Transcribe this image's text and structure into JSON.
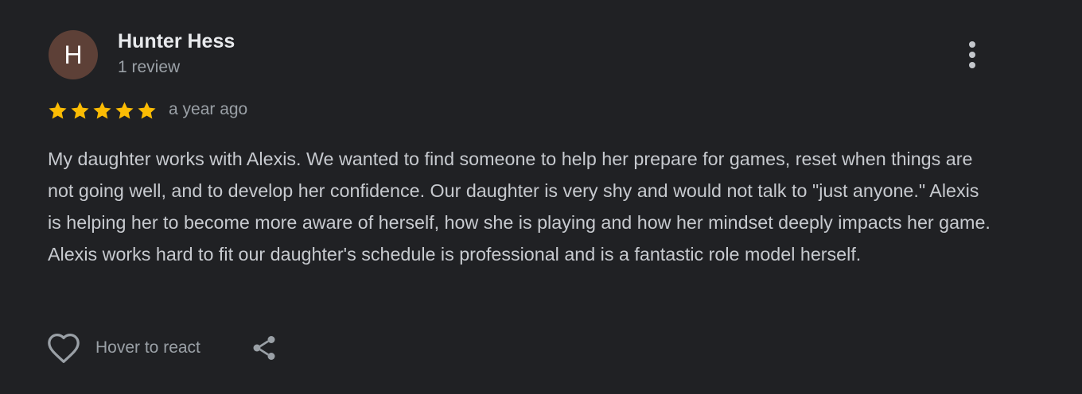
{
  "review": {
    "avatar_letter": "H",
    "author_name": "Hunter Hess",
    "author_meta": "1 review",
    "rating": 5,
    "rating_max": 5,
    "time_ago": "a year ago",
    "text": "My daughter works with Alexis. We wanted to find someone to help her prepare for games, reset when things are not going well, and to develop her confidence. Our daughter is very shy and would not talk to \"just anyone.\" Alexis is helping her to become more aware of herself, how she is playing and how her mindset deeply impacts her game. Alexis works hard to fit our daughter's schedule is professional and is a fantastic role model herself.",
    "react_label": "Hover to react"
  },
  "icons": {
    "more": "more-vert-icon",
    "star": "star-icon",
    "react": "heart-outline-icon",
    "share": "share-icon"
  },
  "colors": {
    "background": "#202124",
    "avatar_bg": "#5d4037",
    "star": "#fbbc04",
    "primary_text": "#e8eaed",
    "secondary_text": "#9aa0a6",
    "body_text": "#c7cacf"
  }
}
